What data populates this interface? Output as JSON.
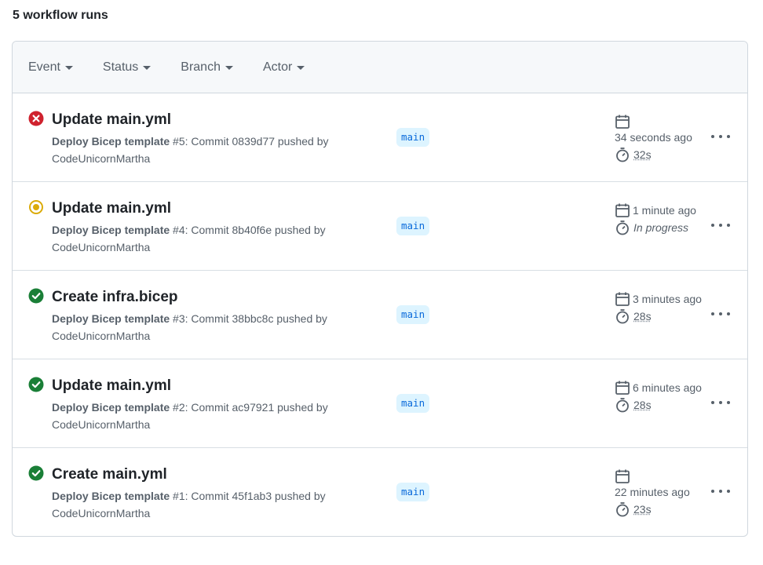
{
  "header": {
    "count_label": "5 workflow runs"
  },
  "filters": [
    {
      "label": "Event"
    },
    {
      "label": "Status"
    },
    {
      "label": "Branch"
    },
    {
      "label": "Actor"
    }
  ],
  "runs": [
    {
      "status": "failure",
      "title": "Update main.yml",
      "workflow": "Deploy Bicep template",
      "run_desc": " #5: Commit 0839d77 pushed by",
      "actor": "CodeUnicornMartha",
      "branch": "main",
      "ago": "34 seconds ago",
      "duration": "32s"
    },
    {
      "status": "in_progress",
      "title": "Update main.yml",
      "workflow": "Deploy Bicep template",
      "run_desc": " #4: Commit 8b40f6e pushed by",
      "actor": "CodeUnicornMartha",
      "branch": "main",
      "ago": "1 minute ago",
      "duration": "In progress"
    },
    {
      "status": "success",
      "title": "Create infra.bicep",
      "workflow": "Deploy Bicep template",
      "run_desc": " #3: Commit 38bbc8c pushed by",
      "actor": "CodeUnicornMartha",
      "branch": "main",
      "ago": "3 minutes ago",
      "duration": "28s"
    },
    {
      "status": "success",
      "title": "Update main.yml",
      "workflow": "Deploy Bicep template",
      "run_desc": " #2: Commit ac97921 pushed by",
      "actor": "CodeUnicornMartha",
      "branch": "main",
      "ago": "6 minutes ago",
      "duration": "28s"
    },
    {
      "status": "success",
      "title": "Create main.yml",
      "workflow": "Deploy Bicep template",
      "run_desc": " #1: Commit 45f1ab3 pushed by",
      "actor": "CodeUnicornMartha",
      "branch": "main",
      "ago": "22 minutes ago",
      "duration": "23s"
    }
  ],
  "colors": {
    "failure": "#cf222e",
    "in_progress": "#dbab09",
    "success": "#1a7f37",
    "branch_text": "#0969da",
    "branch_bg": "#ddf4ff"
  }
}
